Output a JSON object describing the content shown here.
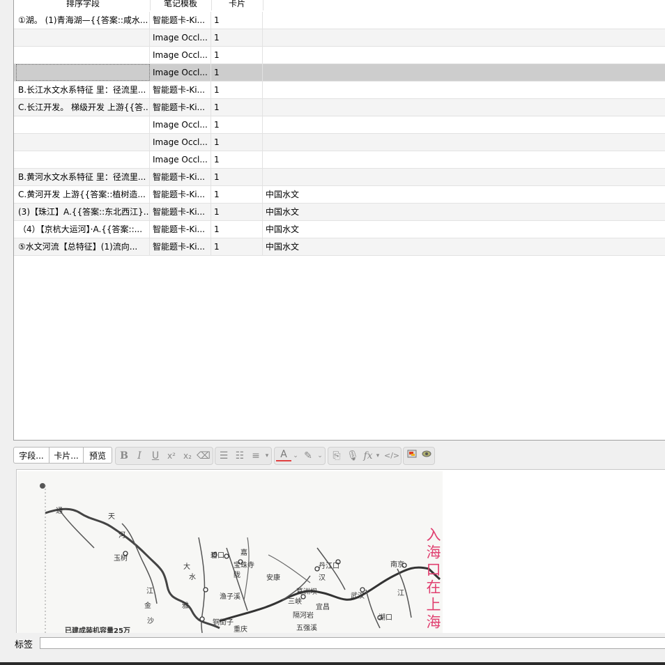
{
  "table": {
    "columns": [
      "排序字段",
      "笔记模板",
      "卡片",
      ""
    ],
    "rows": [
      {
        "sort": "①湖。 (1)青海湖—{{答案::咸水...",
        "model": "智能题卡-Ki...",
        "cards": "1",
        "deck": ""
      },
      {
        "sort": "",
        "model": "Image Occl...",
        "cards": "1",
        "deck": ""
      },
      {
        "sort": "",
        "model": "Image Occl...",
        "cards": "1",
        "deck": ""
      },
      {
        "sort": "",
        "model": "Image Occl...",
        "cards": "1",
        "deck": ""
      },
      {
        "sort": "B.长江水文水系特征 里：径流里...",
        "model": "智能题卡-Ki...",
        "cards": "1",
        "deck": ""
      },
      {
        "sort": "C.长江开发。 梯级开发 上游{{答...",
        "model": "智能题卡-Ki...",
        "cards": "1",
        "deck": ""
      },
      {
        "sort": "",
        "model": "Image Occl...",
        "cards": "1",
        "deck": ""
      },
      {
        "sort": "",
        "model": "Image Occl...",
        "cards": "1",
        "deck": ""
      },
      {
        "sort": "",
        "model": "Image Occl...",
        "cards": "1",
        "deck": ""
      },
      {
        "sort": "B.黄河水文水系特征 里：径流里...",
        "model": "智能题卡-Ki...",
        "cards": "1",
        "deck": ""
      },
      {
        "sort": "C.黄河开发 上游{{答案::植树造...",
        "model": "智能题卡-Ki...",
        "cards": "1",
        "deck": "中国水文"
      },
      {
        "sort": "(3)【珠江】A.{{答案::东北西江}...",
        "model": "智能题卡-Ki...",
        "cards": "1",
        "deck": "中国水文"
      },
      {
        "sort": "（4）【京杭大运河】·A.{{答案::...",
        "model": "智能题卡-Ki...",
        "cards": "1",
        "deck": "中国水文"
      },
      {
        "sort": "⑤水文河流【总特征】(1)流向...",
        "model": "智能题卡-Ki...",
        "cards": "1",
        "deck": "中国水文"
      }
    ]
  },
  "editor": {
    "buttons": {
      "fields": "字段...",
      "cards": "卡片...",
      "preview": "预览"
    },
    "icons": [
      "bold-icon",
      "italic-icon",
      "underline-icon",
      "superscript-icon",
      "subscript-icon",
      "eraser-icon",
      "bullet-list-icon",
      "numbered-list-icon",
      "align-icon",
      "text-color-icon",
      "highlight-icon",
      "attach-icon",
      "record-icon",
      "formula-icon",
      "html-editor-icon",
      "image-occlusion-icon",
      "cloze-icon"
    ]
  },
  "map": {
    "vertical_note": "入海口在上海",
    "labels": [
      "通",
      "天",
      "河",
      "玉树",
      "江",
      "沙",
      "金",
      "大",
      "水",
      "雅",
      "陇",
      "嘉",
      "宝珠寺",
      "安康",
      "丹江口",
      "汉",
      "南京",
      "江",
      "武汉",
      "三峡",
      "葛洲坝",
      "宜昌",
      "隔河岩",
      "五强溪",
      "湖口",
      "重庆",
      "渔子溪",
      "铜街子",
      "碧口",
      "已建成装机容量25万"
    ]
  },
  "tags": {
    "label": "标签",
    "value": ""
  },
  "colors": {
    "accent_red": "#e04070",
    "selected_row": "#cdcdcd"
  }
}
